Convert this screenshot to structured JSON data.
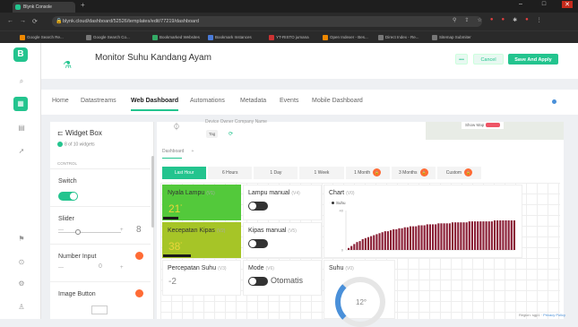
{
  "browser": {
    "tab_title": "Blynk Console",
    "url": "blynk.cloud/dashboard/52526/templates/edit/77219/dashboard",
    "bookmarks": [
      "Google Search Re...",
      "Google Search Co...",
      "Bookmarked Websites",
      "Bookmark Instances",
      "YT-RISTO jumana",
      "Open Indexer - Bes...",
      "Direct Index - Re...",
      "Sitemap Submiter"
    ]
  },
  "sidebar": {
    "logo_letter": "B"
  },
  "header": {
    "title": "Monitor Suhu Kandang Ayam",
    "more_label": "•••",
    "cancel_label": "Cancel",
    "save_label": "Save And Apply"
  },
  "nav": {
    "tabs": [
      "Home",
      "Datastreams",
      "Web Dashboard",
      "Automations",
      "Metadata",
      "Events",
      "Mobile Dashboard"
    ],
    "active": "Web Dashboard"
  },
  "widget_box": {
    "title": "Widget Box",
    "count": "8 of 10 widgets",
    "section": "CONTROL",
    "items": [
      {
        "label": "Switch"
      },
      {
        "label": "Slider",
        "value": "8",
        "minus": "—",
        "plus": "+"
      },
      {
        "label": "Number Input",
        "value": "0",
        "minus": "—",
        "plus": "+"
      },
      {
        "label": "Image Button"
      }
    ]
  },
  "device": {
    "meta": "Device Owner   Company Name",
    "tag": "Tag",
    "show_map": "Show Map"
  },
  "dashboard": {
    "tab_label": "Dashboard",
    "add_label": "+",
    "time_ranges": [
      "Last Hour",
      "6 Hours",
      "1 Day",
      "1 Week",
      "1 Month",
      "3 Months",
      "Custom"
    ],
    "active_range": "Last Hour",
    "locked_ranges": [
      "1 Month",
      "3 Months",
      "Custom"
    ]
  },
  "tiles": {
    "nyala_lampu": {
      "label": "Nyala Lampu",
      "pin": "(V1)",
      "value": "21",
      "unit": "°",
      "progress": 0.2
    },
    "lampu_manual": {
      "label": "Lampu manual",
      "pin": "(V4)"
    },
    "kecepatan_kipas": {
      "label": "Kecepatan Kipas",
      "pin": "(V2)",
      "value": "38",
      "unit": "°",
      "progress": 0.36
    },
    "kipas_manual": {
      "label": "Kipas manual",
      "pin": "(V5)"
    },
    "percepatan_suhu": {
      "label": "Percepatan Suhu",
      "pin": "(V3)",
      "value": "-2"
    },
    "mode": {
      "label": "Mode",
      "pin": "(V6)",
      "toggle_text": "Otomatis"
    },
    "chart": {
      "label": "Chart",
      "pin": "(V0)",
      "legend": "Suhu"
    },
    "suhu": {
      "label": "Suhu",
      "pin": "(V0)",
      "value": "12",
      "unit": "°"
    }
  },
  "chart_data": {
    "type": "bar",
    "title": "Chart",
    "series": [
      {
        "name": "Suhu",
        "values": [
          2,
          4,
          6,
          8,
          9,
          11,
          12,
          13,
          14,
          15,
          16,
          17,
          18,
          19,
          19,
          20,
          21,
          21,
          22,
          22,
          23,
          23,
          24,
          24,
          24,
          25,
          25,
          25,
          26,
          26,
          26,
          26,
          27,
          27,
          27,
          27,
          27,
          28,
          28,
          28,
          28,
          28,
          28,
          29,
          29,
          29,
          29,
          29,
          29,
          29,
          29,
          29,
          30,
          30,
          30,
          30,
          30,
          30,
          30,
          30
        ]
      }
    ],
    "ylim": [
      0,
      40
    ],
    "yticks": [
      "40",
      "0"
    ],
    "colors": {
      "bar": "#8a1f36"
    }
  },
  "footer": {
    "region": "Region: sgp1",
    "privacy": "Privacy Policy"
  },
  "colors": {
    "accent": "#23c48e",
    "lock": "#ff6b35"
  }
}
